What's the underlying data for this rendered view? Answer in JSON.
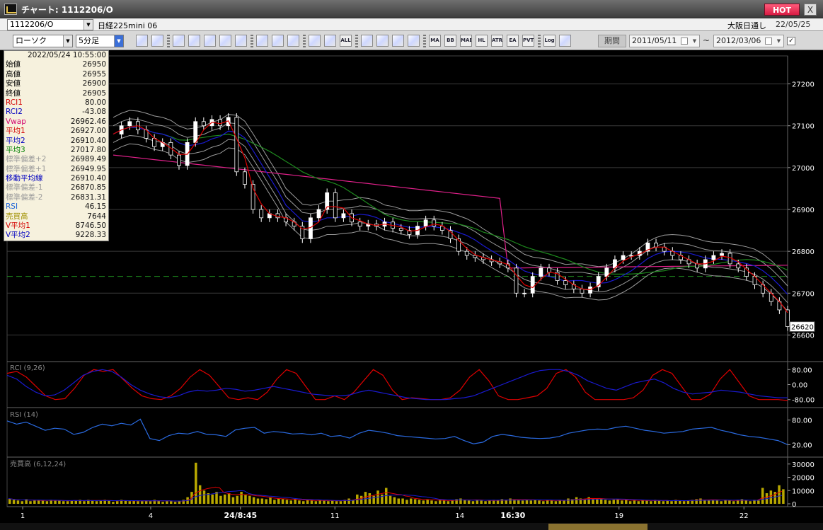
{
  "window": {
    "title": "チャート: 1112206/O",
    "hot_label": "HOT",
    "close_label": "X"
  },
  "infobar": {
    "symbol_code": "1112206/O",
    "symbol_name": "日経225mini 06",
    "exchange": "大阪日通し",
    "date": "22/05/25"
  },
  "toolbar": {
    "chart_type": "ローソク",
    "period": "5分足",
    "buttons": [
      {
        "icon": "zoom-icon",
        "label": ""
      },
      {
        "icon": "layout-icon",
        "label": ""
      },
      {
        "icon": "candle-icon",
        "label": ""
      },
      {
        "icon": "magnifier-icon",
        "label": ""
      },
      {
        "icon": "chart-settings-icon",
        "label": ""
      },
      {
        "icon": "split-icon",
        "label": ""
      },
      {
        "icon": "alert-icon",
        "label": ""
      },
      {
        "icon": "pen-icon",
        "label": ""
      },
      {
        "icon": "cursor-icon",
        "label": ""
      },
      {
        "icon": "redo-icon",
        "label": ""
      },
      {
        "icon": "bar-chart-icon",
        "label": ""
      },
      {
        "icon": "bar-chart2-icon",
        "label": ""
      },
      {
        "icon": "all-icon",
        "label": "ALL"
      },
      {
        "icon": "tools-icon",
        "label": ""
      },
      {
        "icon": "brush-icon",
        "label": ""
      },
      {
        "icon": "palette-icon",
        "label": ""
      },
      {
        "icon": "wave-icon",
        "label": ""
      },
      {
        "icon": "ma-icon",
        "label": "MA"
      },
      {
        "icon": "bb-icon",
        "label": "BB"
      },
      {
        "icon": "mae-icon",
        "label": "MAE"
      },
      {
        "icon": "hl-icon",
        "label": "HL"
      },
      {
        "icon": "atr-icon",
        "label": "ATR"
      },
      {
        "icon": "ea-icon",
        "label": "EA"
      },
      {
        "icon": "pvt-icon",
        "label": "PVT"
      },
      {
        "icon": "log-icon",
        "label": "Log"
      },
      {
        "icon": "print-icon",
        "label": ""
      }
    ],
    "kikan_label": "期間",
    "date_from": "2011/05/11",
    "date_to": "2012/03/06",
    "tilde": "~"
  },
  "data_window": {
    "datetime": "2022/05/24  10:55:00",
    "rows": [
      {
        "label": "始値",
        "value": "26950",
        "color": "#000000"
      },
      {
        "label": "高値",
        "value": "26955",
        "color": "#000000"
      },
      {
        "label": "安値",
        "value": "26900",
        "color": "#000000"
      },
      {
        "label": "終値",
        "value": "26905",
        "color": "#000000"
      },
      {
        "label": "RCI1",
        "value": "80.00",
        "color": "#d40000"
      },
      {
        "label": "RCI2",
        "value": "-43.08",
        "color": "#0000c0"
      },
      {
        "label": "Vwap",
        "value": "26962.46",
        "color": "#d4006e"
      },
      {
        "label": "平均1",
        "value": "26927.00",
        "color": "#d40000"
      },
      {
        "label": "平均2",
        "value": "26910.40",
        "color": "#0000c0"
      },
      {
        "label": "平均3",
        "value": "27017.80",
        "color": "#008000"
      },
      {
        "label": "標準偏差+2",
        "value": "26989.49",
        "color": "#9a9a9a"
      },
      {
        "label": "標準偏差+1",
        "value": "26949.95",
        "color": "#9a9a9a"
      },
      {
        "label": "移動平均線",
        "value": "26910.40",
        "color": "#0000c0"
      },
      {
        "label": "標準偏差-1",
        "value": "26870.85",
        "color": "#9a9a9a"
      },
      {
        "label": "標準偏差-2",
        "value": "26831.31",
        "color": "#9a9a9a"
      },
      {
        "label": "RSI",
        "value": "46.15",
        "color": "#1e64d8"
      },
      {
        "label": "売買高",
        "value": "7644",
        "color": "#a09000"
      },
      {
        "label": "V平均1",
        "value": "8746.50",
        "color": "#d40000"
      },
      {
        "label": "V平均2",
        "value": "9228.33",
        "color": "#0000c0"
      }
    ]
  },
  "colors": {
    "candle": "#ffffff",
    "ma_short": "#e00000",
    "ma_mid": "#1a1ad0",
    "ma_long": "#1e8a1e",
    "vwap": "#e0208a",
    "band": "#9c9c9c",
    "rsi": "#2a6ae0",
    "volume": "#b8a800",
    "hline": "#1e8a1e"
  },
  "chart_data": [
    {
      "type": "candlestick",
      "name": "price",
      "y_ticks": [
        "27200",
        "27100",
        "27000",
        "26900",
        "26800",
        "26700",
        "26600"
      ],
      "y_range": [
        26550,
        27250
      ],
      "current_price_label": "26620",
      "dashed_level": 26740,
      "close_path": [
        27080,
        27100,
        27110,
        27090,
        27070,
        27050,
        27060,
        27030,
        27005,
        27060,
        27110,
        27100,
        27115,
        27100,
        27120,
        26990,
        26960,
        26900,
        26880,
        26890,
        26880,
        26870,
        26860,
        26830,
        26880,
        26900,
        26940,
        26880,
        26890,
        26870,
        26860,
        26865,
        26860,
        26870,
        26855,
        26850,
        26840,
        26860,
        26875,
        26860,
        26850,
        26830,
        26800,
        26790,
        26785,
        26780,
        26775,
        26770,
        26760,
        26700,
        26700,
        26740,
        26760,
        26750,
        26730,
        26720,
        26710,
        26700,
        26715,
        26740,
        26760,
        26780,
        26790,
        26790,
        26800,
        26820,
        26810,
        26800,
        26790,
        26780,
        26770,
        26760,
        26780,
        26790,
        26795,
        26770,
        26760,
        26740,
        26720,
        26700,
        26680,
        26660,
        26620
      ],
      "x_ticks": [
        {
          "label": "1",
          "pos": 0.02
        },
        {
          "label": "4",
          "pos": 0.184
        },
        {
          "label": "24/8:45",
          "pos": 0.299
        },
        {
          "label": "11",
          "pos": 0.42
        },
        {
          "label": "14",
          "pos": 0.58
        },
        {
          "label": "16:30",
          "pos": 0.648
        },
        {
          "label": "19",
          "pos": 0.784
        },
        {
          "label": "22",
          "pos": 0.944
        }
      ]
    },
    {
      "type": "line",
      "name": "RCI",
      "title": "RCI (9,26)",
      "y_ticks": [
        "80.00",
        "0.00",
        "-80.00"
      ],
      "y_range": [
        -100,
        100
      ],
      "series": [
        {
          "values": [
            60,
            70,
            40,
            -10,
            -60,
            -80,
            -75,
            -20,
            50,
            80,
            70,
            80,
            30,
            -20,
            -60,
            -75,
            -80,
            -60,
            -20,
            40,
            80,
            50,
            -10,
            -70,
            -80,
            -70,
            -80,
            -40,
            30,
            80,
            60,
            -10,
            -80,
            -80,
            -60,
            -80,
            -40,
            20,
            80,
            50,
            -30,
            -80,
            -70,
            -75,
            -80,
            -80,
            -70,
            -30,
            40,
            80,
            20,
            -60,
            -80,
            -80,
            -70,
            -60,
            -20,
            60,
            80,
            40,
            -40,
            -80,
            -80,
            -80,
            -80,
            -70,
            -30,
            50,
            80,
            60,
            -10,
            -80,
            -80,
            -50,
            30,
            80,
            10,
            -60,
            -80,
            -80,
            -80,
            -85
          ]
        },
        {
          "values": [
            50,
            30,
            -10,
            -40,
            -60,
            -55,
            -30,
            10,
            50,
            70,
            80,
            70,
            40,
            0,
            -30,
            -50,
            -65,
            -70,
            -60,
            -40,
            -30,
            -35,
            -30,
            -20,
            -25,
            -35,
            -30,
            -20,
            -10,
            -20,
            -30,
            -40,
            -50,
            -55,
            -60,
            -60,
            -55,
            -40,
            -30,
            -40,
            -50,
            -60,
            -70,
            -75,
            -80,
            -80,
            -80,
            -75,
            -70,
            -60,
            -40,
            -20,
            0,
            20,
            40,
            60,
            75,
            80,
            80,
            70,
            50,
            20,
            0,
            -20,
            -30,
            -10,
            10,
            20,
            30,
            10,
            -20,
            -40,
            -50,
            -45,
            -40,
            -30,
            -35,
            -40,
            -50,
            -60,
            -65,
            -70,
            -70
          ]
        }
      ]
    },
    {
      "type": "line",
      "name": "RSI",
      "title": "RSI (14)",
      "y_ticks": [
        "80.00",
        "20.00"
      ],
      "y_range": [
        0,
        100
      ],
      "series": [
        {
          "values": [
            78,
            70,
            75,
            65,
            55,
            60,
            58,
            45,
            50,
            62,
            70,
            66,
            72,
            68,
            82,
            35,
            30,
            42,
            48,
            46,
            52,
            45,
            44,
            40,
            56,
            60,
            62,
            48,
            52,
            50,
            46,
            47,
            44,
            48,
            40,
            42,
            36,
            48,
            55,
            52,
            48,
            42,
            40,
            38,
            36,
            34,
            35,
            40,
            30,
            22,
            26,
            40,
            45,
            42,
            38,
            36,
            35,
            36,
            40,
            48,
            52,
            56,
            58,
            57,
            62,
            65,
            60,
            55,
            52,
            48,
            50,
            52,
            58,
            60,
            62,
            55,
            50,
            44,
            40,
            38,
            34,
            30,
            20
          ]
        }
      ]
    },
    {
      "type": "bar",
      "name": "volume",
      "title": "売買高 (6,12,24)",
      "y_ticks": [
        "30000",
        "20000",
        "10000",
        "0"
      ],
      "y_range": [
        0,
        32000
      ],
      "values": [
        4000,
        3000,
        2500,
        2000,
        3500,
        2000,
        2500,
        3000,
        2500,
        2000,
        3000,
        2500,
        2500,
        2000,
        2000,
        2500,
        2500,
        3000,
        2000,
        3000,
        2500,
        2000,
        2500,
        3000,
        2500,
        1500,
        2000,
        3000,
        2500,
        2000,
        2500,
        2000,
        2000,
        2500,
        2000,
        3000,
        2500,
        1500,
        2000,
        2000,
        1500,
        2000,
        3000,
        5000,
        9000,
        31000,
        14000,
        10000,
        8000,
        7000,
        9000,
        6000,
        7000,
        8000,
        5000,
        6000,
        9000,
        7000,
        6000,
        5000,
        4000,
        4000,
        3500,
        5000,
        3000,
        4000,
        3500,
        3000,
        2500,
        3500,
        2500,
        2000,
        3000,
        2500,
        2000,
        3000,
        2500,
        2000,
        2500,
        2000,
        2000,
        3000,
        4000,
        3000,
        7000,
        6000,
        9000,
        8000,
        6000,
        10000,
        7000,
        12000,
        6000,
        5000,
        4000,
        4000,
        3000,
        4000,
        3500,
        3000,
        2500,
        3000,
        2500,
        2000,
        3000,
        2500,
        2000,
        3000,
        3500,
        4000,
        3000,
        2500,
        2000,
        3000,
        2500,
        2000,
        2500,
        3000,
        2500,
        3500,
        3000,
        4000,
        3500,
        3000,
        2500,
        3000,
        2500,
        3000,
        2500,
        2000,
        3000,
        2500,
        2000,
        3000,
        2500,
        4000,
        3500,
        5000,
        4000,
        3000,
        5000,
        4000,
        3500,
        4000,
        3000,
        2500,
        3000,
        3500,
        2500,
        3000,
        2000,
        2500,
        2000,
        3000,
        2500,
        2000,
        3000,
        2500,
        2000,
        2500,
        2000,
        3000,
        2500,
        2000,
        2500,
        3000,
        3500,
        4000,
        3000,
        2500,
        3000,
        2500,
        2000,
        3000,
        2500,
        2000,
        3000,
        3500,
        2500,
        2000,
        3000,
        2500,
        12000,
        8000,
        10000,
        9000,
        14000,
        11000
      ]
    }
  ]
}
